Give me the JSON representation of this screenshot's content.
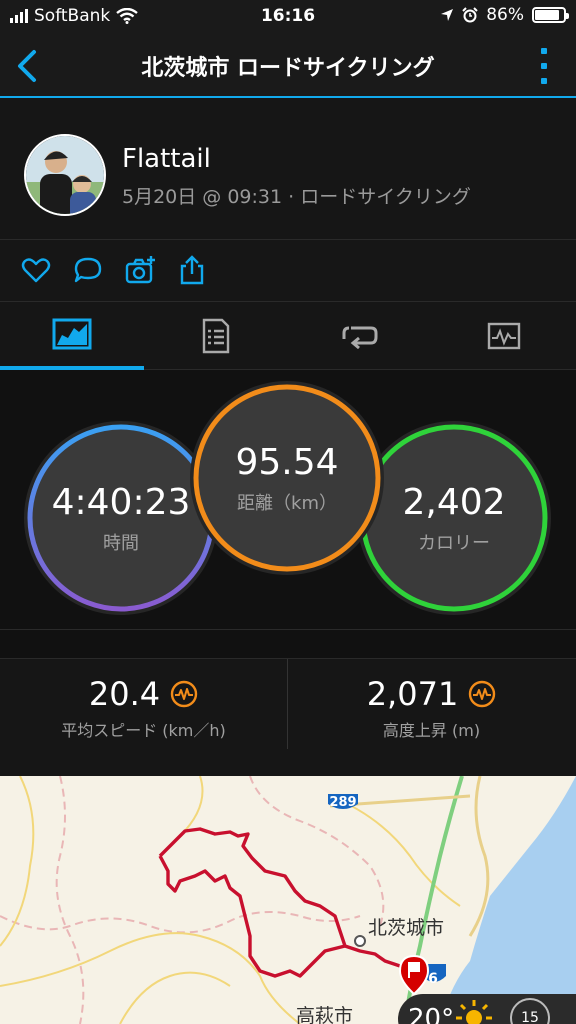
{
  "status": {
    "carrier": "SoftBank",
    "time": "16:16",
    "battery": "86%",
    "battery_level": 0.86
  },
  "nav": {
    "title": "北茨城市 ロードサイクリング"
  },
  "profile": {
    "name": "Flattail",
    "meta": "5月20日 @ 09:31 · ロードサイクリング"
  },
  "social": {
    "icons": [
      "heart-icon",
      "comment-icon",
      "camera-plus-icon",
      "share-icon"
    ]
  },
  "tabs": [
    "overview-tab",
    "details-tab",
    "laps-tab",
    "charts-tab"
  ],
  "stats": {
    "time": {
      "value": "4:40:23",
      "label": "時間"
    },
    "distance": {
      "value": "95.54",
      "label": "距離（km）"
    },
    "calories": {
      "value": "2,402",
      "label": "カロリー"
    }
  },
  "metrics": {
    "avg_speed": {
      "value": "20.4",
      "label": "平均スピード (km／h)"
    },
    "elev_gain": {
      "value": "2,071",
      "label": "高度上昇 (m)"
    }
  },
  "map": {
    "route_badge": "289",
    "city_label": "北茨城市",
    "city_label2": "高萩市",
    "route6": "6",
    "weather_temp": "20°",
    "weather_wind": "15"
  },
  "colors": {
    "accent": "#11a9ed",
    "time_ring": "#5b8fe0",
    "distance_ring": "#f28c1a",
    "calories_ring": "#2fd33a",
    "route": "#c8102e"
  }
}
